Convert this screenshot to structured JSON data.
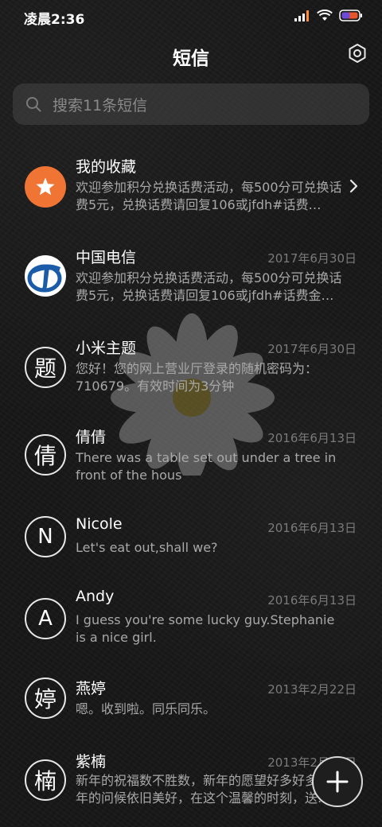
{
  "status_bar": {
    "time": "凌晨2:36",
    "icons": [
      "signal-icon",
      "wifi-icon",
      "battery-icon"
    ]
  },
  "header": {
    "title": "短信",
    "settings_icon": "settings-icon"
  },
  "search": {
    "placeholder": "搜索11条短信"
  },
  "conversations": [
    {
      "name": "我的收藏",
      "date": "",
      "preview": "欢迎参加积分兑换话费活动，每500分可兑换话费5元，兑换话费请回复106或jfdh#话费…",
      "avatar_type": "star",
      "has_chevron": true
    },
    {
      "name": "中国电信",
      "date": "2017年6月30日",
      "preview": "欢迎参加积分兑换话费活动，每500分可兑换话费5元，兑换话费请回复106或jfdh#话费金…",
      "avatar_type": "telecom-logo"
    },
    {
      "name": "小米主题",
      "date": "2017年6月30日",
      "preview": "您好！您的网上营业厅登录的随机密码为：710679。有效时间为3分钟",
      "avatar_letter": "题"
    },
    {
      "name": "倩倩",
      "date": "2016年6月13日",
      "preview": "There was a table set out under a tree in front of the hous",
      "avatar_letter": "倩"
    },
    {
      "name": "Nicole",
      "date": "2016年6月13日",
      "preview": "Let's eat out,shall we?",
      "avatar_letter": "N"
    },
    {
      "name": "Andy",
      "date": "2016年6月13日",
      "preview": "I guess you're some lucky guy.Stephanie is a nice girl.",
      "avatar_letter": "A"
    },
    {
      "name": "燕婷",
      "date": "2013年2月22日",
      "preview": "嗯。收到啦。同乐同乐。",
      "avatar_letter": "婷"
    },
    {
      "name": "紫楠",
      "date": "2013年2月22日",
      "preview": "新年的祝福数不胜数，新年的愿望好多好多，新年的问候依旧美好，在这个温馨的时刻，送…",
      "avatar_letter": "楠"
    }
  ],
  "fab": {
    "icon": "plus-icon"
  },
  "colors": {
    "background": "#171717",
    "favorite_avatar": "#f07434",
    "telecom_blue": "#1a5ca8",
    "date_text": "#7a7a7a",
    "preview_text": "#a9a9a9"
  }
}
